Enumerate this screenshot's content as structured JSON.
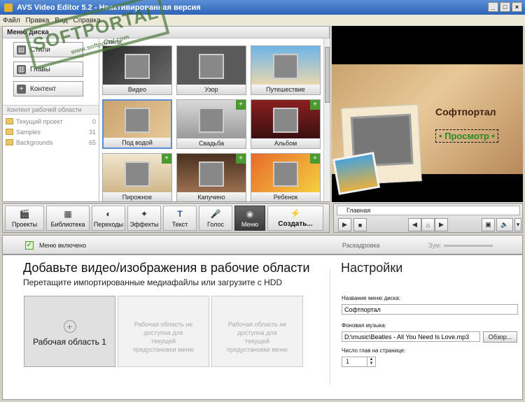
{
  "window": {
    "title": "AVS Video Editor 5.2 - Неактивированная версия",
    "controls": [
      "_",
      "□",
      "×"
    ]
  },
  "menubar": [
    "Файл",
    "Правка",
    "Вид",
    "Справка"
  ],
  "left_panel": {
    "header": "Меню диска",
    "disk_buttons": [
      "Стили",
      "Главы",
      "Контент"
    ],
    "content_header": "Контент рабочей области",
    "folders": [
      {
        "name": "Текущий проект",
        "count": "0"
      },
      {
        "name": "Samples",
        "count": "31"
      },
      {
        "name": "Backgrounds",
        "count": "65"
      }
    ],
    "themes_header": "Стили",
    "themes": [
      "Видео",
      "Узор",
      "Путешествие",
      "Под водой",
      "Свадьба",
      "Альбом",
      "Пирожное",
      "Капучино",
      "Ребенок"
    ]
  },
  "preview": {
    "title": "Софтпортал",
    "button": "• Просмотр •"
  },
  "toolbar": {
    "items": [
      "Проекты",
      "Библиотека",
      "Переходы",
      "Эффекты",
      "Текст",
      "Голос",
      "Меню",
      "Создать..."
    ]
  },
  "player": {
    "tab": "Главная"
  },
  "statusbar": {
    "menu_enabled": "Меню включено",
    "storyboard": "Раскадровка",
    "zoom": "Зум:"
  },
  "workarea": {
    "title": "Добавьте видео/изображения в рабочие области",
    "subtitle": "Перетащите импортированные медиафайлы или загрузите с HDD",
    "slot1": "Рабочая область 1",
    "slot_disabled": "Рабочая область не доступна для текущей предустановки меню"
  },
  "settings": {
    "title": "Настройки",
    "disk_name_label": "Название меню диска:",
    "disk_name_value": "Софтпортал",
    "music_label": "Фоновая музыка:",
    "music_value": "D:\\music\\Beatles - All You Need Is Love.mp3",
    "browse": "Обзор...",
    "chapters_label": "Число глав на странице:",
    "chapters_value": "1"
  },
  "watermark": {
    "text": "SOFTPORTAL",
    "url": "www.softportal.com"
  }
}
